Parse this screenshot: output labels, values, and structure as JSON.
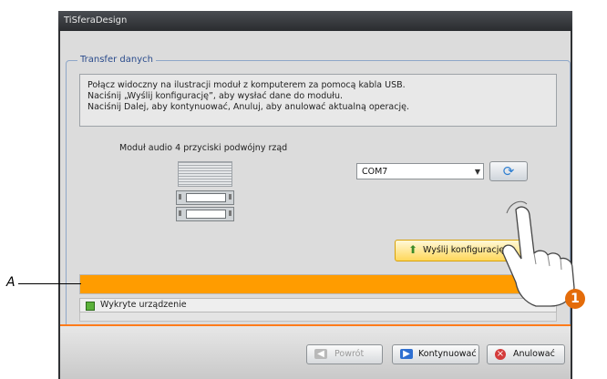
{
  "window": {
    "title": "TiSferaDesign"
  },
  "group": {
    "title": "Transfer danych"
  },
  "info": {
    "lines": [
      "Połącz widoczny na ilustracji moduł z komputerem za pomocą kabla USB.",
      "Naciśnij „Wyślij konfigurację”, aby wysłać dane do modułu.",
      "Naciśnij Dalej, aby kontynuować, Anuluj, aby anulować aktualną operację."
    ]
  },
  "device": {
    "name": "Moduł audio 4 przyciski podwójny rząd"
  },
  "port": {
    "selected": "COM7"
  },
  "buttons": {
    "send": "Wyślij konfigurację",
    "back": "Powrót",
    "continue": "Kontynuować",
    "cancel": "Anulować"
  },
  "progress": {
    "value": 1.0,
    "color": "#ff9c00"
  },
  "status": {
    "text": "Wykryte urządzenie",
    "color": "#5bb13a"
  },
  "annotations": {
    "label_a": "A",
    "step_badge": "1"
  },
  "icons": {
    "refresh": "refresh-icon",
    "send": "upload-icon",
    "back": "arrow-left-icon",
    "continue": "arrow-right-icon",
    "cancel": "cancel-icon"
  },
  "colors": {
    "accent": "#ff7b1a",
    "badge": "#e46c0a"
  }
}
